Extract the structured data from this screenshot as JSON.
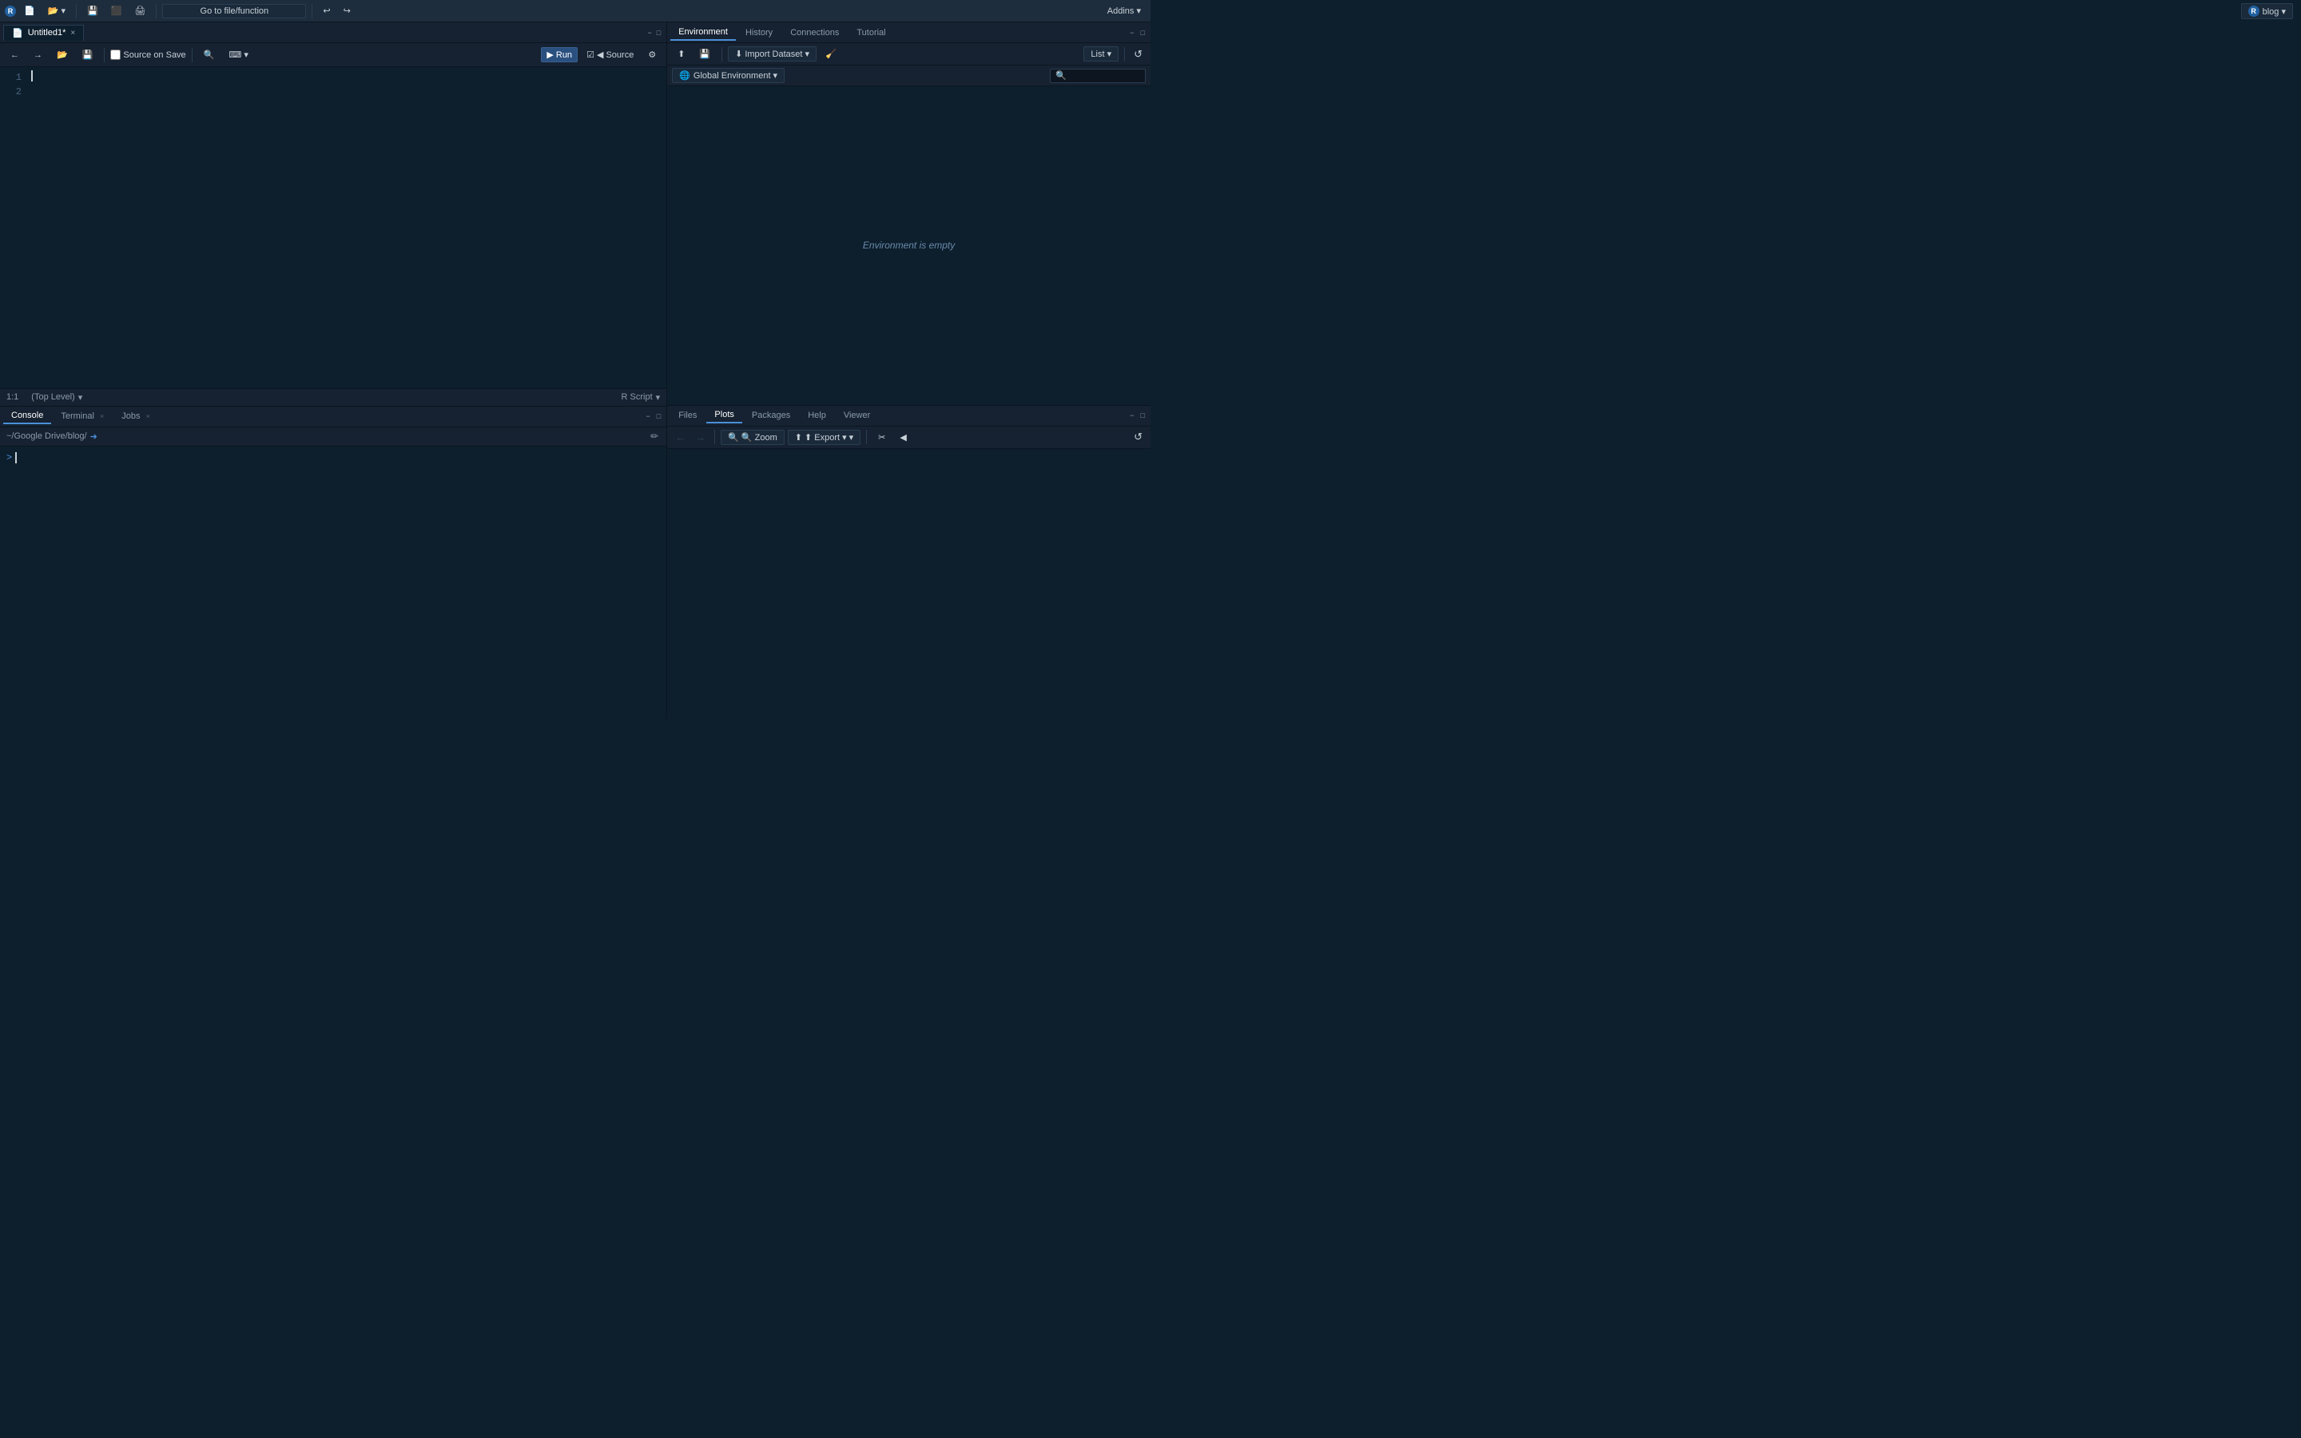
{
  "app": {
    "title": "RStudio",
    "blog_badge": "blog ▾"
  },
  "top_toolbar": {
    "buttons": [
      {
        "label": "⊞",
        "name": "new-file"
      },
      {
        "label": "💾",
        "name": "save"
      },
      {
        "label": "📂",
        "name": "open"
      },
      {
        "label": "◻",
        "name": "new-project"
      },
      {
        "label": "⬛",
        "name": "new-script"
      },
      {
        "label": "🖨",
        "name": "print"
      }
    ],
    "go_to_file": "Go to file/function",
    "addins": "Addins ▾"
  },
  "editor": {
    "tab_label": "Untitled1*",
    "tab_close": "×",
    "toolbar": {
      "back": "←",
      "forward": "→",
      "open": "📂",
      "save": "💾",
      "source_on_save": "Source on Save",
      "search": "🔍",
      "code": "⌨",
      "run": "Run",
      "source": "◀ Source",
      "options": "⚙"
    },
    "lines": [
      "",
      ""
    ],
    "status": {
      "position": "1:1",
      "scope": "(Top Level)",
      "type": "R Script"
    }
  },
  "console": {
    "tabs": [
      {
        "label": "Console",
        "active": true
      },
      {
        "label": "Terminal",
        "active": false,
        "close": "×"
      },
      {
        "label": "Jobs",
        "active": false,
        "close": "×"
      }
    ],
    "path": "~/Google Drive/blog/",
    "prompt": ">"
  },
  "env_panel": {
    "tabs": [
      {
        "label": "Environment",
        "active": true
      },
      {
        "label": "History",
        "active": false
      },
      {
        "label": "Connections",
        "active": false
      },
      {
        "label": "Tutorial",
        "active": false
      }
    ],
    "toolbar": {
      "import": "Import Dataset ▾",
      "list_view": "List ▾",
      "refresh": "↺"
    },
    "env_selector": "Global Environment ▾",
    "search_placeholder": "🔍",
    "empty_message": "Environment is empty"
  },
  "files_panel": {
    "tabs": [
      {
        "label": "Files",
        "active": false
      },
      {
        "label": "Plots",
        "active": true
      },
      {
        "label": "Packages",
        "active": false
      },
      {
        "label": "Help",
        "active": false
      },
      {
        "label": "Viewer",
        "active": false
      }
    ],
    "toolbar": {
      "back": "←",
      "forward": "→",
      "zoom": "🔍 Zoom",
      "export": "⬆ Export ▾",
      "remove": "✂",
      "clear": "◀",
      "refresh": "↺"
    }
  },
  "window": {
    "min": "−",
    "max": "□"
  }
}
